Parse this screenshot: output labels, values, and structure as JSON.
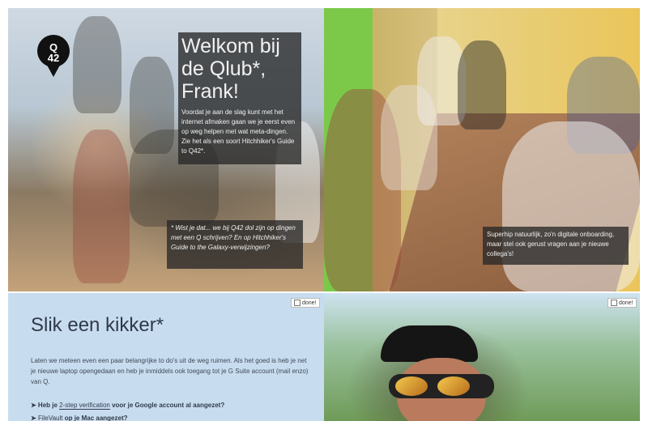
{
  "logo": {
    "line1": "Q",
    "line2": "42"
  },
  "welcome": {
    "title": "Welkom bij de Qlub*, Frank!",
    "body": "Voordat je aan de slag kunt met het internet afmaken gaan we je eerst even op weg helpen met wat meta-dingen. Zie het als een soort Hitchhiker's Guide to Q42*."
  },
  "fact": {
    "text": "* Wist je dat... we bij Q42 dol zijn op dingen met een Q schrijven? En op Hitchhiker's Guide to the Galaxy-verwijzingen?"
  },
  "superhip": {
    "text": "Superhip natuurlijk, zo'n digitale onboarding, maar stel ook gerust vragen aan je nieuwe collega's!"
  },
  "card": {
    "title": "Slik een kikker*",
    "intro": "Laten we meteen even een paar belangrijke to do's uit de weg ruimen. Als het goed is heb je net je nieuwe laptop opengedaan en heb je inmiddels ook toegang tot je G Suite account (mail enzo) van Q.",
    "items": [
      {
        "prefix": "➤ Heb je ",
        "link": "2-step verification",
        "suffix": " voor je Google account al aangezet?"
      },
      {
        "prefix": "➤ ",
        "link": "FileVault",
        "suffix": " op je Mac aangezet?"
      }
    ]
  },
  "done_label": "done!"
}
